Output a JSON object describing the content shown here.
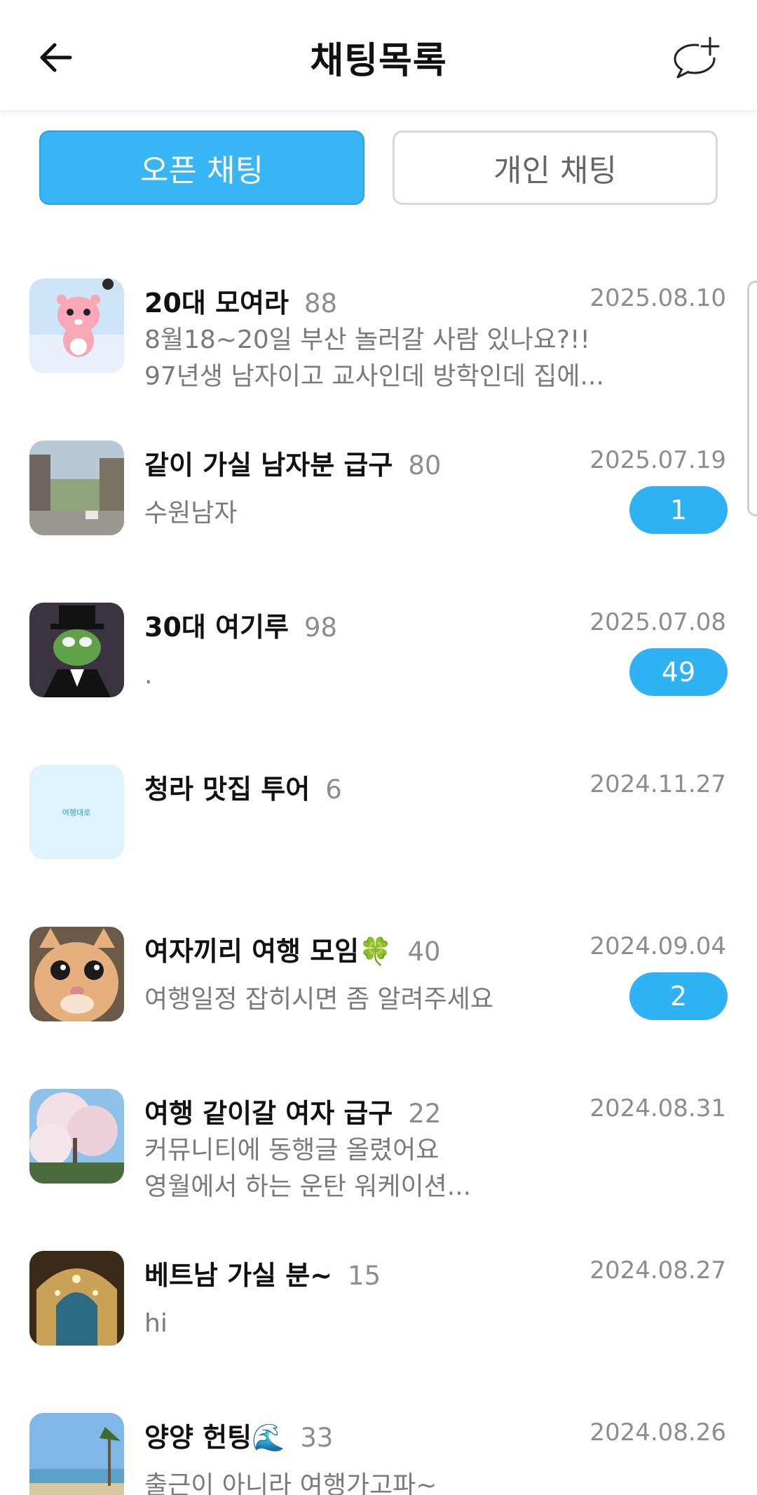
{
  "header": {
    "title": "채팅목록",
    "back_icon": "arrow-left-icon",
    "new_chat_icon": "chat-bubble-plus-icon"
  },
  "tabs": {
    "open_label": "오픈 채팅",
    "private_label": "개인 채팅",
    "active": "open"
  },
  "colors": {
    "accent": "#37b5f5",
    "badge": "#2eb2f4",
    "muted": "#8d8d8d"
  },
  "chats": [
    {
      "name": "20대 모여라",
      "count": "88",
      "date": "2025.08.10",
      "preview": [
        "8월18~20일 부산 놀러갈 사람 있나요?!!",
        "97년생 남자이고 교사인데 방학인데 집에..."
      ],
      "badge": ""
    },
    {
      "name": "같이 가실 남자분 급구",
      "count": "80",
      "date": "2025.07.19",
      "preview": [
        "수원남자"
      ],
      "badge": "1"
    },
    {
      "name": "30대 여기루",
      "count": "98",
      "date": "2025.07.08",
      "preview": [
        "."
      ],
      "badge": "49"
    },
    {
      "name": "청라 맛집 투어",
      "count": "6",
      "date": "2024.11.27",
      "preview": [],
      "badge": ""
    },
    {
      "name": "여자끼리 여행 모임🍀",
      "count": "40",
      "date": "2024.09.04",
      "preview": [
        "여행일정 잡히시면 좀 알려주세요"
      ],
      "badge": "2"
    },
    {
      "name": "여행 같이갈 여자 급구",
      "count": "22",
      "date": "2024.08.31",
      "preview": [
        "커뮤니티에 동행글 올렸어요",
        "영월에서 하는 운탄 워케이션..."
      ],
      "badge": ""
    },
    {
      "name": "베트남 가실 분~",
      "count": "15",
      "date": "2024.08.27",
      "preview": [
        "hi"
      ],
      "badge": ""
    },
    {
      "name": "양양 헌팅🌊",
      "count": "33",
      "date": "2024.08.26",
      "preview": [
        "출근이 아니라 여행가고파~"
      ],
      "badge": ""
    }
  ],
  "avatar_icons": [
    "pink-beaver-avatar",
    "street-photo-avatar",
    "frog-tuxedo-avatar",
    "travel-logo-avatar",
    "cat-avatar",
    "cherry-blossom-avatar",
    "arch-gate-avatar",
    "beach-avatar"
  ],
  "avatar_logo_text": "여행대로"
}
